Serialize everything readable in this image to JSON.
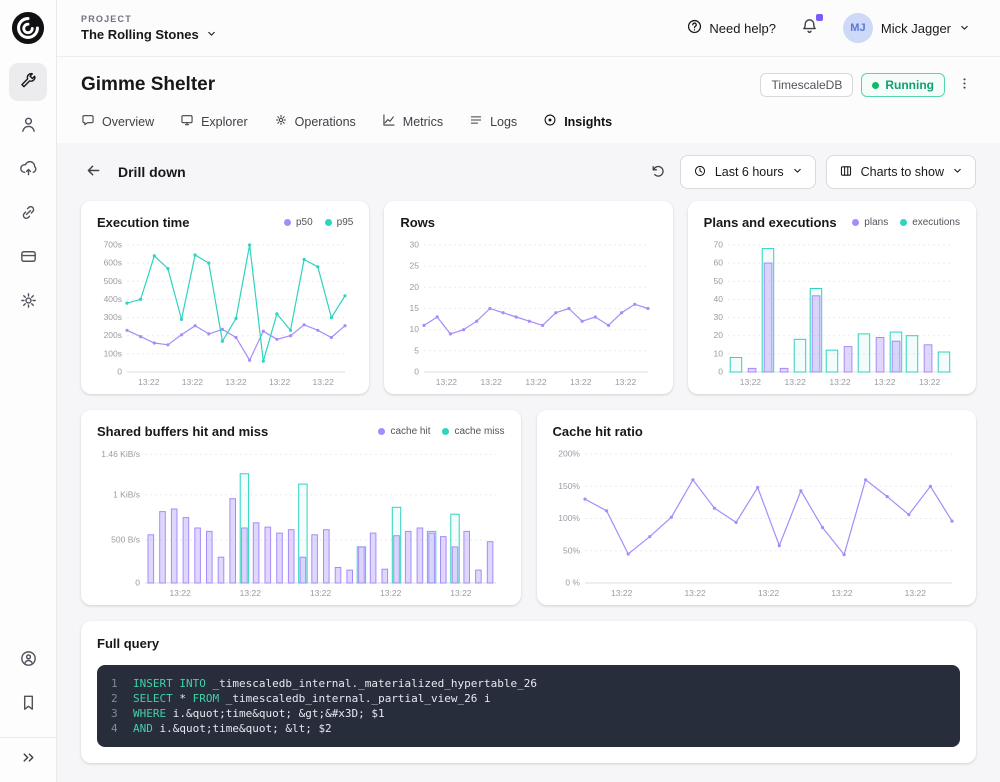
{
  "sidebar": {
    "items": [
      "services",
      "people",
      "cloud-upload",
      "integrations",
      "billing",
      "settings"
    ],
    "bottom_items": [
      "support",
      "bookmarks",
      "expand"
    ]
  },
  "header": {
    "project_label": "PROJECT",
    "project_name": "The Rolling Stones",
    "help_label": "Need help?",
    "user_initials": "MJ",
    "user_name": "Mick Jagger"
  },
  "page": {
    "title": "Gimme Shelter",
    "db_badge": "TimescaleDB",
    "status_badge": "Running",
    "status_color": "#12b76a",
    "accent_purple": "#a78bfa",
    "accent_teal": "#2dd4bf"
  },
  "tabs": [
    {
      "label": "Overview"
    },
    {
      "label": "Explorer"
    },
    {
      "label": "Operations"
    },
    {
      "label": "Metrics"
    },
    {
      "label": "Logs"
    },
    {
      "label": "Insights",
      "active": true
    }
  ],
  "drilldown": {
    "title": "Drill down",
    "time_range_label": "Last 6 hours",
    "charts_select_label": "Charts to show"
  },
  "charts": {
    "execution_time": {
      "title": "Execution time",
      "type": "line",
      "legend": [
        {
          "label": "p50",
          "color": "#a78bfa"
        },
        {
          "label": "p95",
          "color": "#2dd4bf"
        }
      ],
      "ymax": 700,
      "yticks": [
        {
          "v": 700,
          "label": "700s"
        },
        {
          "v": 600,
          "label": "600s"
        },
        {
          "v": 500,
          "label": "500s"
        },
        {
          "v": 400,
          "label": "400s"
        },
        {
          "v": 300,
          "label": "300s"
        },
        {
          "v": 200,
          "label": "200s"
        },
        {
          "v": 100,
          "label": "100s"
        },
        {
          "v": 0,
          "label": "0"
        }
      ],
      "xticks": [
        "13:22",
        "13:22",
        "13:22",
        "13:22",
        "13:22"
      ],
      "series": [
        {
          "name": "p50",
          "color": "#a78bfa",
          "values": [
            230,
            195,
            160,
            150,
            205,
            255,
            210,
            235,
            190,
            65,
            225,
            180,
            200,
            260,
            230,
            190,
            255
          ]
        },
        {
          "name": "p95",
          "color": "#2dd4bf",
          "values": [
            380,
            400,
            640,
            570,
            290,
            645,
            600,
            170,
            295,
            700,
            60,
            320,
            230,
            620,
            580,
            300,
            420
          ]
        }
      ]
    },
    "rows": {
      "title": "Rows",
      "type": "line",
      "legend": [],
      "ymax": 30,
      "yticks": [
        {
          "v": 30,
          "label": "30"
        },
        {
          "v": 25,
          "label": "25"
        },
        {
          "v": 20,
          "label": "20"
        },
        {
          "v": 15,
          "label": "15"
        },
        {
          "v": 10,
          "label": "10"
        },
        {
          "v": 5,
          "label": "5"
        },
        {
          "v": 0,
          "label": "0"
        }
      ],
      "xticks": [
        "13:22",
        "13:22",
        "13:22",
        "13:22",
        "13:22"
      ],
      "series": [
        {
          "name": "rows",
          "color": "#a78bfa",
          "values": [
            11,
            13,
            9,
            10,
            12,
            15,
            14,
            13,
            12,
            11,
            14,
            15,
            12,
            13,
            11,
            14,
            16,
            15
          ]
        }
      ]
    },
    "plans_executions": {
      "title": "Plans and executions",
      "type": "bar",
      "legend": [
        {
          "label": "plans",
          "color": "#a78bfa"
        },
        {
          "label": "executions",
          "color": "#2dd4bf"
        }
      ],
      "ymax": 70,
      "yticks": [
        {
          "v": 70,
          "label": "70"
        },
        {
          "v": 60,
          "label": "60"
        },
        {
          "v": 50,
          "label": "50"
        },
        {
          "v": 40,
          "label": "40"
        },
        {
          "v": 30,
          "label": "30"
        },
        {
          "v": 20,
          "label": "20"
        },
        {
          "v": 10,
          "label": "10"
        },
        {
          "v": 0,
          "label": "0"
        }
      ],
      "xticks": [
        "13:22",
        "13:22",
        "13:22",
        "13:22",
        "13:22"
      ],
      "series": [
        {
          "name": "executions",
          "color": "#2dd4bf",
          "fill": "rgba(45,212,191,0.06)",
          "values": [
            8,
            0,
            68,
            0,
            18,
            46,
            12,
            0,
            21,
            0,
            22,
            20,
            0,
            11
          ]
        },
        {
          "name": "plans",
          "color": "#a78bfa",
          "fill": "rgba(167,139,250,0.35)",
          "values": [
            0,
            2,
            60,
            2,
            0,
            42,
            0,
            14,
            0,
            19,
            17,
            0,
            15,
            0
          ]
        }
      ]
    },
    "shared_buffers": {
      "title": "Shared buffers hit and miss",
      "type": "bar",
      "legend": [
        {
          "label": "cache hit",
          "color": "#a78bfa"
        },
        {
          "label": "cache miss",
          "color": "#2dd4bf"
        }
      ],
      "ymax": 1500,
      "yticks": [
        {
          "v": 1495,
          "label": "1.46 KiB/s"
        },
        {
          "v": 1024,
          "label": "1 KiB/s"
        },
        {
          "v": 500,
          "label": "500 B/s"
        },
        {
          "v": 0,
          "label": "0"
        }
      ],
      "xticks": [
        "13:22",
        "13:22",
        "13:22",
        "13:22",
        "13:22"
      ],
      "series": [
        {
          "name": "cache miss",
          "color": "#2dd4bf",
          "fill": "rgba(45,212,191,0.05)",
          "values": [
            0,
            0,
            0,
            0,
            0,
            0,
            0,
            0,
            1270,
            0,
            0,
            0,
            0,
            1150,
            0,
            0,
            0,
            0,
            420,
            0,
            0,
            880,
            0,
            0,
            600,
            0,
            800,
            0,
            0,
            0
          ]
        },
        {
          "name": "cache hit",
          "color": "#a78bfa",
          "fill": "rgba(167,139,250,0.35)",
          "values": [
            560,
            830,
            860,
            760,
            640,
            600,
            300,
            980,
            640,
            700,
            650,
            580,
            620,
            300,
            560,
            620,
            180,
            150,
            420,
            580,
            160,
            550,
            600,
            640,
            580,
            540,
            420,
            600,
            150,
            480
          ]
        }
      ]
    },
    "cache_hit_ratio": {
      "title": "Cache hit ratio",
      "type": "line",
      "legend": [],
      "ymax": 200,
      "yticks": [
        {
          "v": 200,
          "label": "200%"
        },
        {
          "v": 150,
          "label": "150%"
        },
        {
          "v": 100,
          "label": "100%"
        },
        {
          "v": 50,
          "label": "50%"
        },
        {
          "v": 0,
          "label": "0 %"
        }
      ],
      "xticks": [
        "13:22",
        "13:22",
        "13:22",
        "13:22",
        "13:22"
      ],
      "series": [
        {
          "name": "cache hit ratio",
          "color": "#a78bfa",
          "values": [
            130,
            112,
            45,
            72,
            102,
            160,
            116,
            94,
            148,
            58,
            143,
            86,
            44,
            160,
            134,
            106,
            150,
            96
          ]
        }
      ]
    }
  },
  "full_query": {
    "title": "Full query",
    "lines": [
      [
        [
          "kw",
          "INSERT INTO"
        ],
        [
          "pl",
          " _timescaledb_internal._materialized_hypertable_26"
        ]
      ],
      [
        [
          "kw",
          "SELECT"
        ],
        [
          "pl",
          " * "
        ],
        [
          "kw",
          "FROM"
        ],
        [
          "pl",
          " _timescaledb_internal._partial_view_26 i"
        ]
      ],
      [
        [
          "kw",
          "WHERE"
        ],
        [
          "pl",
          " i.&quot;time&quot; &gt;&#x3D; $1"
        ]
      ],
      [
        [
          "kw",
          "AND"
        ],
        [
          "pl",
          " i.&quot;time&quot; &lt; $2"
        ]
      ]
    ]
  }
}
